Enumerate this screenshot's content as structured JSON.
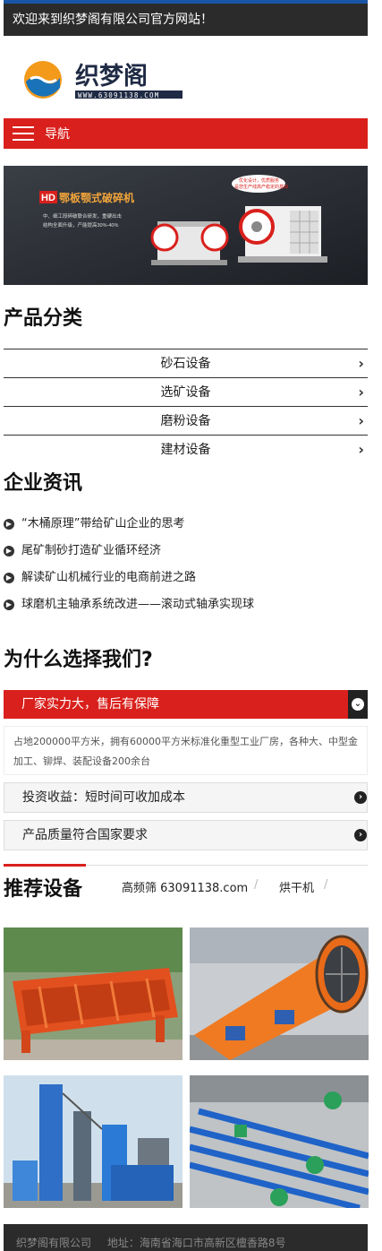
{
  "topbar": {
    "welcome": "欢迎来到织梦阁有限公司官方网站！"
  },
  "header": {
    "logo_text": "织梦阁",
    "logo_url": "WWW.63091138.COM"
  },
  "nav": {
    "label": "导航"
  },
  "banner": {
    "tag_hd": "HD",
    "headline": "鄂板颚式破碎机",
    "features": [
      "中、细工段碎破联合研发，重硬出击",
      "结构全面升级，产能提高30%-40%"
    ],
    "bubble1": "优化设计，优质服务",
    "bubble2": "是您生产线高产稳定的基础"
  },
  "categories": {
    "title": "产品分类",
    "items": [
      {
        "label": "砂石设备"
      },
      {
        "label": "选矿设备"
      },
      {
        "label": "磨粉设备"
      },
      {
        "label": "建材设备"
      }
    ]
  },
  "news": {
    "title": "企业资讯",
    "items": [
      {
        "label": "“木桶原理”带给矿山企业的思考"
      },
      {
        "label": "尾矿制砂打造矿业循环经济"
      },
      {
        "label": "解读矿山机械行业的电商前进之路"
      },
      {
        "label": "球磨机主轴承系统改进——滚动式轴承实现球"
      }
    ]
  },
  "why": {
    "title": "为什么选择我们?",
    "open_label": "厂家实力大，售后有保障",
    "open_body": "占地200000平方米，拥有60000平方米标准化重型工业厂房，各种大、中型金加工、铆焊、装配设备200余台",
    "closed": [
      {
        "label": "投资收益：短时间可收加成本"
      },
      {
        "label": "产品质量符合国家要求"
      }
    ]
  },
  "recommend": {
    "title": "推荐设备",
    "tabs": [
      {
        "label": "高频筛 63091138.com"
      },
      {
        "label": "烘干机"
      }
    ]
  },
  "footer": {
    "company": "织梦阁有限公司",
    "address": "地址：海南省海口市高新区檀香路8号"
  },
  "colors": {
    "accent": "#d9201c",
    "dark": "#2b2b2b",
    "topline": "#1a56a6"
  }
}
